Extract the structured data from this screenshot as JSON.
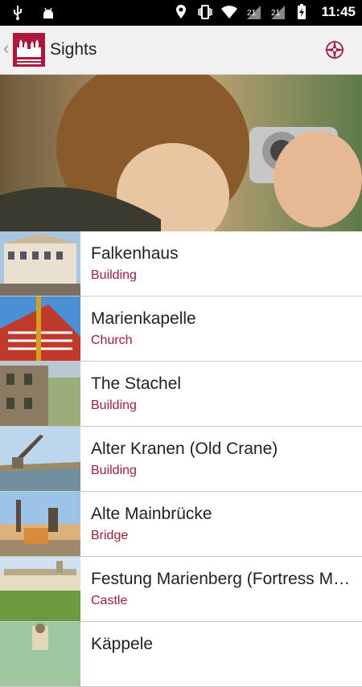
{
  "status_bar": {
    "time": "11:45",
    "icons": [
      "usb-icon",
      "android-icon",
      "location-icon",
      "vibrate-icon",
      "wifi-icon",
      "signal-icon",
      "signal-icon",
      "battery-charging-icon"
    ]
  },
  "app_bar": {
    "title": "Sights",
    "back_icon": "chevron-left-icon",
    "logo_icon": "city-logo-icon",
    "action_icon": "compass-icon"
  },
  "hero": {
    "image": "woman-with-camera-photo"
  },
  "sights": [
    {
      "name": "Falkenhaus",
      "category": "Building",
      "thumb": "falkenhaus"
    },
    {
      "name": "Marienkapelle",
      "category": "Church",
      "thumb": "marienkapelle"
    },
    {
      "name": "The Stachel",
      "category": "Building",
      "thumb": "stachel"
    },
    {
      "name": "Alter Kranen (Old Crane)",
      "category": "Building",
      "thumb": "kranen"
    },
    {
      "name": "Alte Mainbrücke",
      "category": "Bridge",
      "thumb": "bridge"
    },
    {
      "name": "Festung Marienberg (Fortress Marienberg)",
      "category": "Castle",
      "thumb": "fortress"
    },
    {
      "name": "Käppele",
      "category": "",
      "thumb": "kaeppele"
    }
  ],
  "colors": {
    "accent": "#a71b35",
    "logo": "#b0163a",
    "appbar_bg": "#f1f1f1"
  }
}
